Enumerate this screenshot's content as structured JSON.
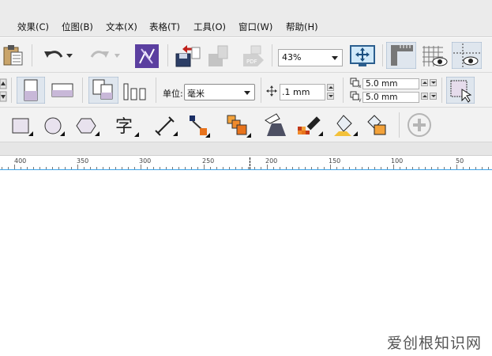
{
  "menubar": {
    "items": [
      {
        "label": "效果(C)",
        "name": "menu-effects"
      },
      {
        "label": "位图(B)",
        "name": "menu-bitmaps"
      },
      {
        "label": "文本(X)",
        "name": "menu-text"
      },
      {
        "label": "表格(T)",
        "name": "menu-table"
      },
      {
        "label": "工具(O)",
        "name": "menu-tools"
      },
      {
        "label": "窗口(W)",
        "name": "menu-window"
      },
      {
        "label": "帮助(H)",
        "name": "menu-help"
      }
    ]
  },
  "standard_toolbar": {
    "zoom_level": "43%"
  },
  "property_bar": {
    "units_label": "单位:",
    "units_value": "毫米",
    "nudge_value": ".1 mm",
    "duplicate_x": "5.0 mm",
    "duplicate_y": "5.0 mm"
  },
  "ruler": {
    "labels": [
      "400",
      "350",
      "300",
      "250",
      "200",
      "150",
      "100",
      "50"
    ]
  },
  "watermark": "爱创根知识网",
  "colors": {
    "accent_orange": "#e8731c",
    "accent_purple": "#5b3fa0",
    "ruler_line": "#3fa4e8"
  }
}
